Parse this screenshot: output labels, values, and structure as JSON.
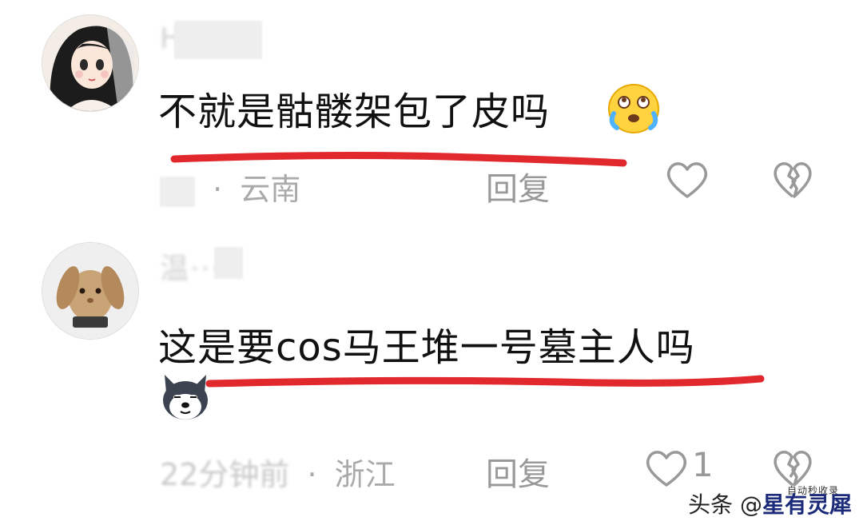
{
  "comments": [
    {
      "username": "H··d··",
      "text": "不就是骷髅架包了皮吗",
      "emoji": "crying-laughing-emoji",
      "time": "",
      "region": "云南",
      "reply_label": "回复",
      "like_count": ""
    },
    {
      "username": "温··· ·",
      "text": "这是要cos马王堆一号墓主人吗",
      "emoji": "husky-dog-emoji",
      "time": "22分钟前",
      "region": "浙江",
      "reply_label": "回复",
      "like_count": "1"
    }
  ],
  "watermark": {
    "prefix": "头条 @",
    "brand": "星有灵犀",
    "tag": "自动秒收录"
  },
  "colors": {
    "underline": "#e0282d",
    "meta_text": "#aaaaaa",
    "icon_stroke": "#999999"
  }
}
